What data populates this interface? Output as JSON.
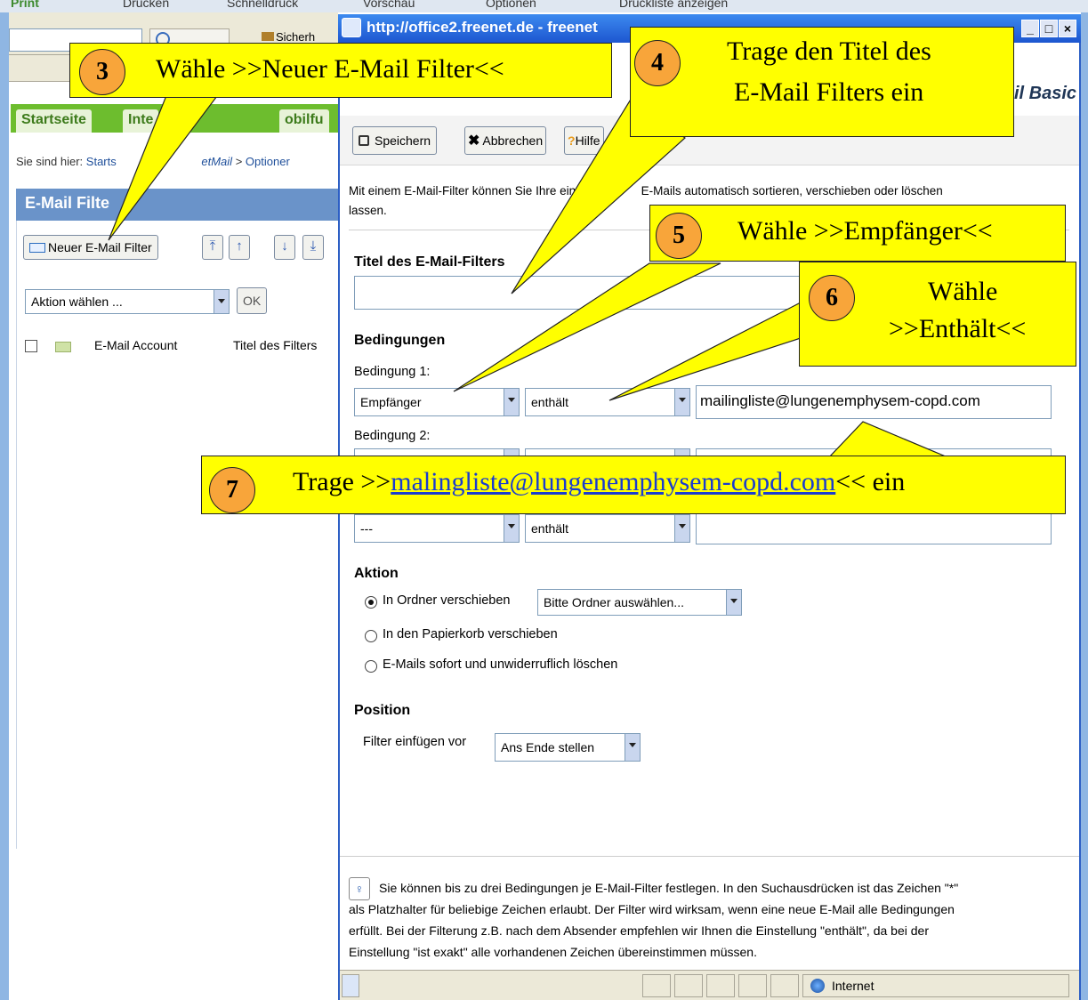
{
  "browser": {
    "menu_items": [
      "Print",
      "Drucken",
      "Schnelldruck",
      "Vorschau",
      "Optionen",
      "Druckliste anzeigen"
    ],
    "toolbar_fragment": "Sicherh"
  },
  "background_page": {
    "tabs": [
      "Startseite",
      "Inte",
      "obilfu"
    ],
    "breadcrumb_prefix": "Sie sind hier:",
    "breadcrumb_start": "Starts",
    "breadcrumb_mail": "etMail",
    "breadcrumb_separator": ">",
    "breadcrumb_options": "Optioner",
    "panel_title": "E-Mail Filte",
    "new_filter_button": "Neuer E-Mail Filter",
    "action_select": "Aktion wählen ...",
    "ok_button": "OK",
    "column_account": "E-Mail Account",
    "column_title": "Titel des Filters",
    "arrow_buttons": [
      "⤒",
      "↑",
      "↓",
      "⤓"
    ]
  },
  "popup": {
    "title": "http://office2.freenet.de - freenet",
    "window_buttons": [
      "_",
      "□",
      "×"
    ],
    "brand": "il Basic",
    "toolbar": {
      "save": "Speichern",
      "cancel": "Abbrechen",
      "help": "Hilfe"
    },
    "info_line1": "Mit einem E-Mail-Filter können Sie Ihre eing",
    "info_line1_tail": "E-Mails automatisch sortieren, verschieben oder löschen",
    "info_line2": "lassen.",
    "filter_title_label": "Titel des E-Mail-Filters",
    "filter_title_value": "",
    "conditions_heading": "Bedingungen",
    "condition1_label": "Bedingung 1:",
    "condition1_field": "Empfänger",
    "condition1_operator": "enthält",
    "condition1_value": "mailingliste@lungenemphysem-copd.com",
    "condition2_label": "Bedingung 2:",
    "condition3_field": "---",
    "condition3_operator": "enthält",
    "condition3_value": "",
    "action_heading": "Aktion",
    "action_move_label": "In Ordner verschieben",
    "action_folder_select": "Bitte Ordner auswählen...",
    "action_trash_label": "In den Papierkorb verschieben",
    "action_delete_label": "E-Mails sofort und unwiderruflich löschen",
    "position_heading": "Position",
    "position_label": "Filter einfügen vor",
    "position_select": "Ans Ende stellen",
    "hint_lines": [
      "Sie können bis zu drei Bedingungen je E-Mail-Filter festlegen. In den Suchausdrücken ist das Zeichen \"*\"",
      "als Platzhalter für beliebige Zeichen erlaubt. Der Filter wird wirksam, wenn eine neue E-Mail alle Bedingungen",
      "erfüllt. Bei der Filterung z.B. nach dem Absender empfehlen wir Ihnen die Einstellung \"enthält\", da bei der",
      "Einstellung \"ist exakt\" alle vorhandenen Zeichen übereinstimmen müssen."
    ],
    "status_zone": "Internet"
  },
  "callouts": {
    "c3": {
      "number": "3",
      "text": "Wähle >>Neuer E-Mail Filter<<"
    },
    "c4": {
      "number": "4",
      "line1": "Trage den Titel des",
      "line2": "E-Mail Filters ein"
    },
    "c5": {
      "number": "5",
      "text": "Wähle >>Empfänger<<"
    },
    "c6": {
      "number": "6",
      "line1": "Wähle",
      "line2": ">>Enthält<<"
    },
    "c7": {
      "number": "7",
      "prefix": "Trage >>",
      "link": "malingliste@lungenemphysem-copd.com",
      "suffix": "<< ein"
    }
  },
  "colors": {
    "callout_fill": "#ffff00",
    "badge_fill": "#f8a53a",
    "tab_green": "#6dbd2e",
    "panel_blue": "#6a93c9",
    "titlebar_blue": "#1d56d0"
  }
}
